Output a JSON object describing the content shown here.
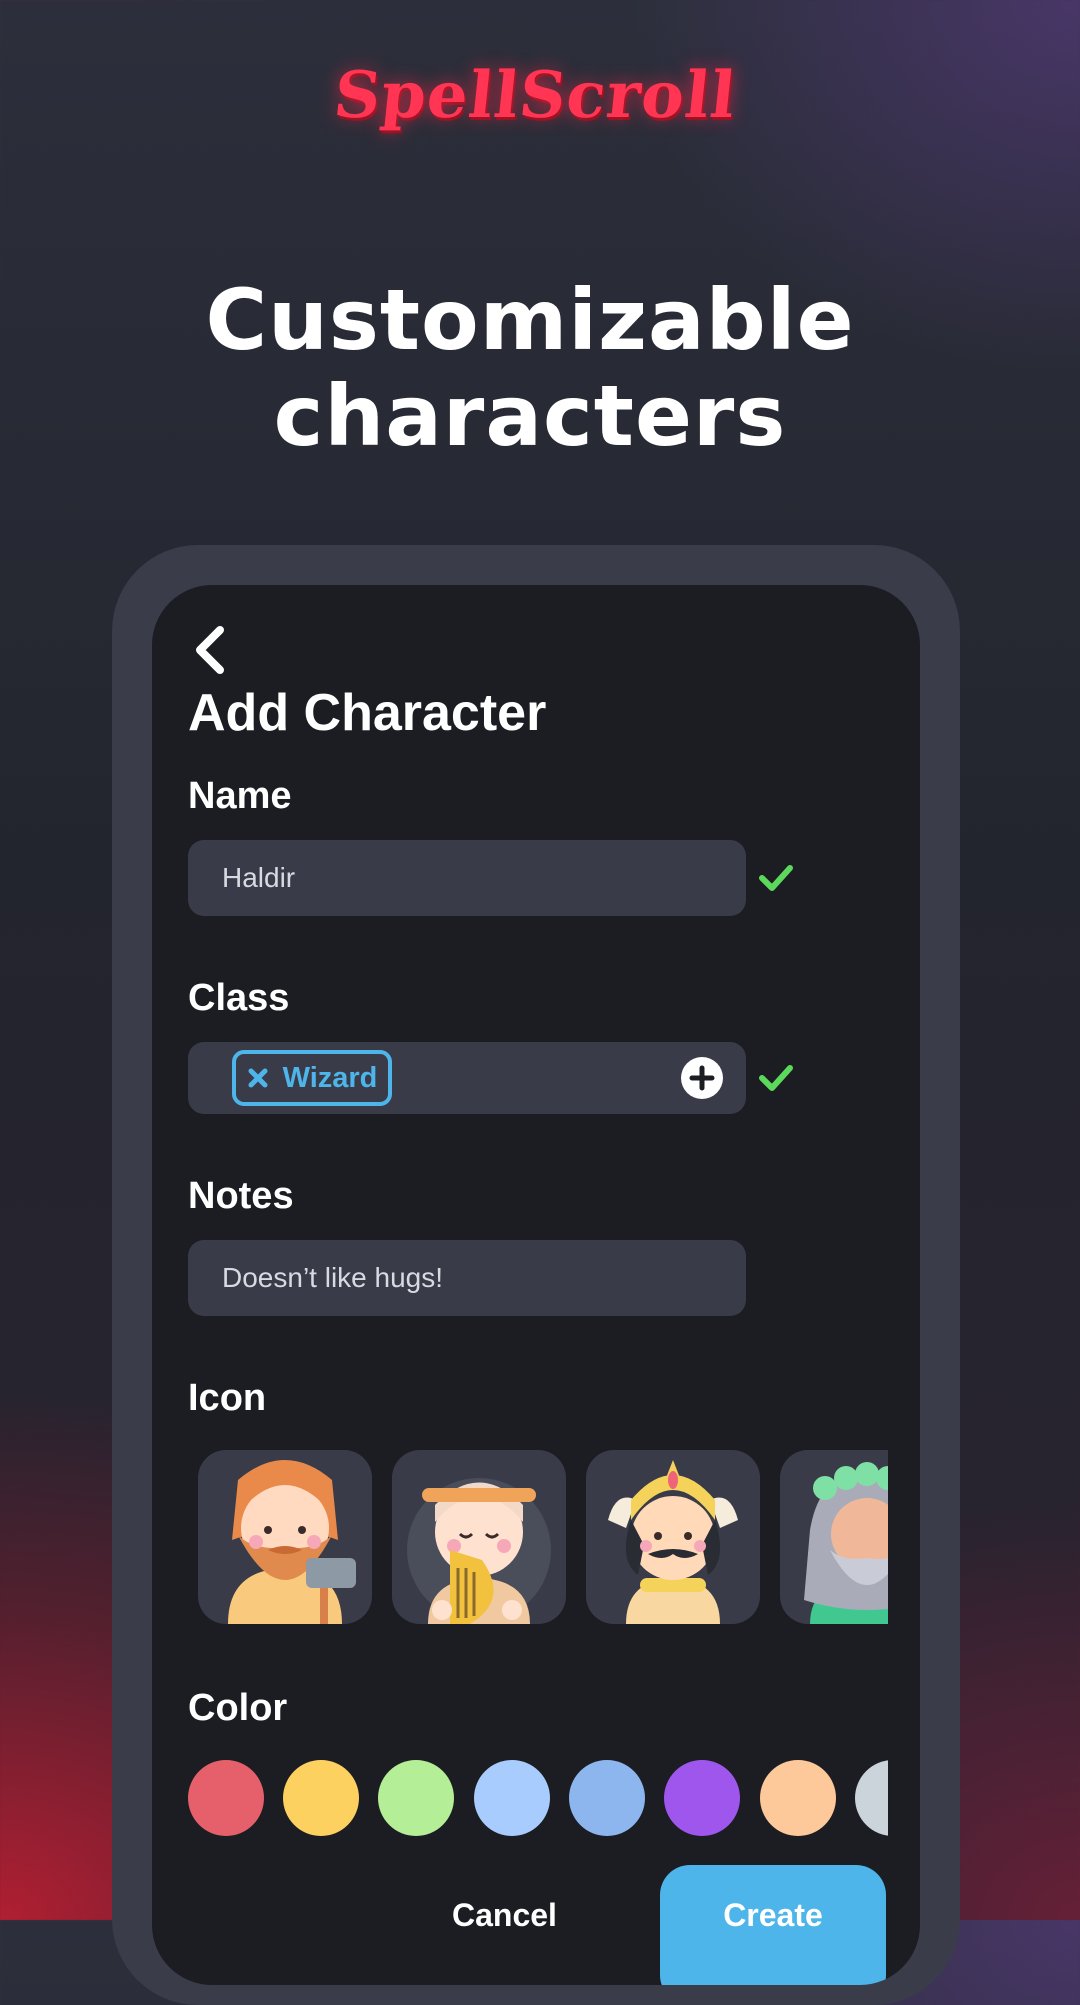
{
  "brand": {
    "logo_text": "SpellScroll"
  },
  "promo": {
    "headline_line1": "Customizable",
    "headline_line2": "characters"
  },
  "form": {
    "title": "Add Character",
    "back_icon": "chevron-left-icon",
    "name": {
      "label": "Name",
      "value": "Haldir",
      "valid": true
    },
    "class": {
      "label": "Class",
      "chips": [
        "Wizard"
      ],
      "valid": true,
      "add_icon": "plus-circle-icon"
    },
    "notes": {
      "label": "Notes",
      "value": "Doesn’t like hugs!"
    },
    "icon": {
      "label": "Icon",
      "options": [
        "dwarf-blacksmith-icon",
        "bard-harp-icon",
        "warrior-king-icon",
        "elder-druid-icon"
      ]
    },
    "color": {
      "label": "Color",
      "swatches": [
        "#e5606a",
        "#fdd160",
        "#b4ee96",
        "#a8ccfd",
        "#8db6ef",
        "#9f56ed",
        "#fdc99a",
        "#cbd3db"
      ]
    },
    "actions": {
      "cancel_label": "Cancel",
      "create_label": "Create"
    }
  },
  "colors": {
    "accent": "#4db5ea",
    "valid": "#5cd95c",
    "brand": "#ff3553"
  }
}
